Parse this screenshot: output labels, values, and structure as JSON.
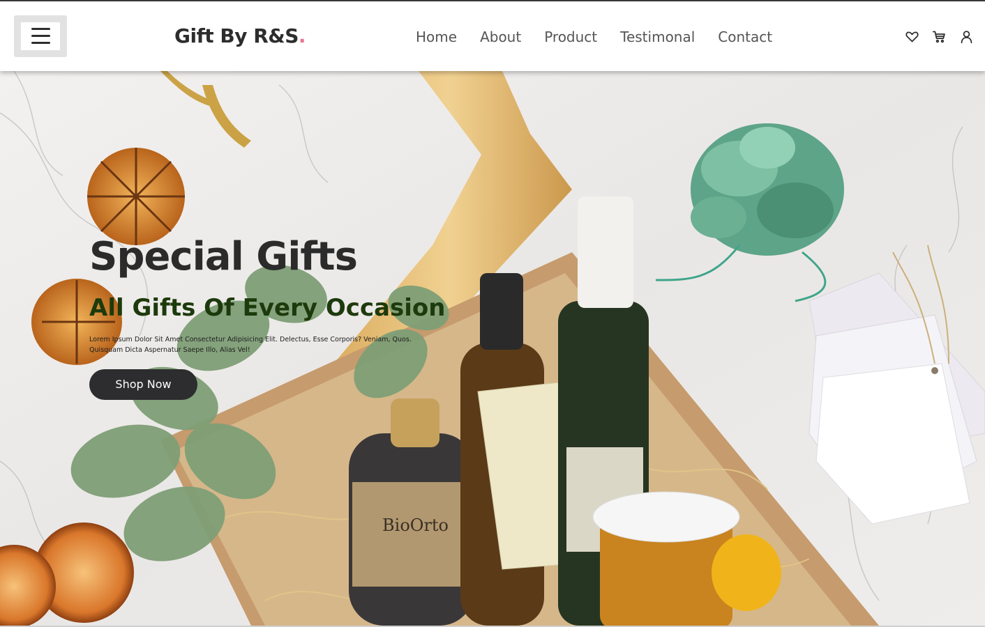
{
  "header": {
    "menu_icon": "hamburger-icon",
    "logo_text": "Gift By R&S",
    "logo_dot": ".",
    "logo_dot_color": "#e9758f",
    "nav": [
      {
        "label": "Home"
      },
      {
        "label": "About"
      },
      {
        "label": "Product"
      },
      {
        "label": "Testimonal"
      },
      {
        "label": "Contact"
      }
    ],
    "icons": [
      "heart-icon",
      "cart-icon",
      "user-icon"
    ]
  },
  "hero": {
    "title": "Special Gifts",
    "subtitle": "All Gifts Of Every Occasion",
    "description": "Lorem Ipsum Dolor Sit Amet Consectetur Adipisicing Elit. Delectus, Esse Corporis? Veniam, Quos. Quisquam Dicta Aspernatur Saepe Illo, Alias Vel!",
    "button_label": "Shop Now",
    "image": "gift-basket-photo"
  },
  "colors": {
    "text_dark": "#2d2d2d",
    "subtitle_green": "#1d3a0c",
    "button_bg": "#2d2d2f",
    "accent_pink": "#e9758f"
  }
}
